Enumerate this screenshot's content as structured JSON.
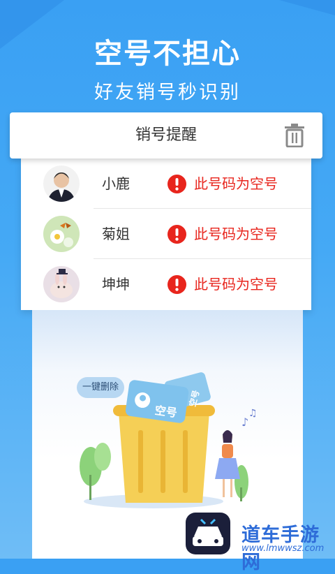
{
  "headline": "空号不担心",
  "subheadline": "好友销号秒识别",
  "panel": {
    "title": "销号提醒",
    "rows": [
      {
        "name": "小鹿",
        "status": "此号码为空号"
      },
      {
        "name": "菊姐",
        "status": "此号码为空号"
      },
      {
        "name": "坤坤",
        "status": "此号码为空号"
      }
    ]
  },
  "illustration": {
    "bubble": "一键删除",
    "card_label": "空号",
    "card_label_2": "空号"
  },
  "watermark": {
    "text": "道车手游网",
    "url": "www.lmwwsz.com"
  },
  "colors": {
    "background": "#3aa0f3",
    "warning": "#e8251d",
    "watermark": "#2e6cd8"
  }
}
